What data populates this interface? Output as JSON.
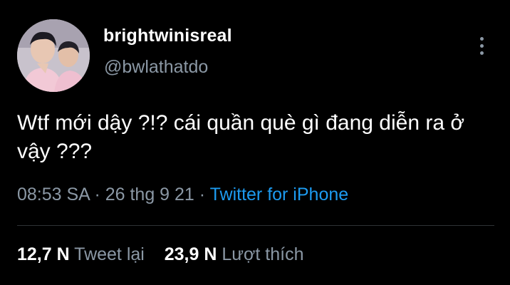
{
  "author": {
    "display_name": "brightwinisreal",
    "handle": "@bwlathatdo",
    "avatar_icon": "profile-photo"
  },
  "tweet": {
    "text": "Wtf mới dậy ?!? cái quần què gì đang diễn ra ở vậy ???",
    "time": "08:53 SA",
    "separator": "·",
    "date": "26 thg 9 21",
    "source": "Twitter for iPhone"
  },
  "stats": {
    "retweets_count": "12,7 N",
    "retweets_label": "Tweet lại",
    "likes_count": "23,9 N",
    "likes_label": "Lượt thích"
  },
  "colors": {
    "background": "#000000",
    "primary_text": "#ffffff",
    "secondary_text": "#8b98a5",
    "link": "#1d9bf0",
    "divider": "#2f3336"
  },
  "menu": {
    "icon": "more-vertical-icon"
  }
}
